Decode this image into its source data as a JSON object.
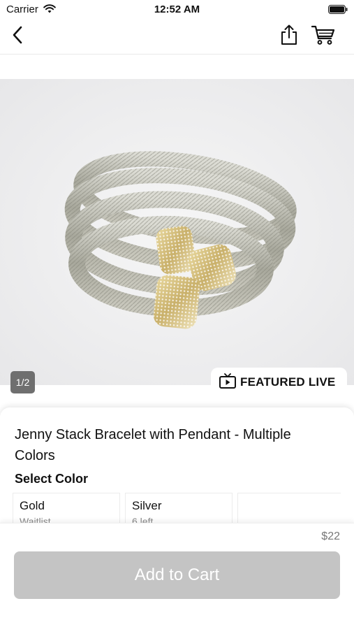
{
  "status_bar": {
    "carrier": "Carrier",
    "time": "12:52 AM"
  },
  "nav": {
    "back_icon": "chevron-left-icon",
    "share_icon": "share-icon",
    "cart_icon": "cart-icon"
  },
  "gallery": {
    "page_indicator": "1/2",
    "badge_icon": "tv-play-icon",
    "badge_label": "FEATURED LIVE"
  },
  "product": {
    "title": "Jenny Stack Bracelet with Pendant - Multiple Colors",
    "select_color_label": "Select Color",
    "colors": [
      {
        "name": "Gold",
        "status": "Waitlist"
      },
      {
        "name": "Silver",
        "status": "6 left"
      }
    ],
    "price": "$22"
  },
  "actions": {
    "add_to_cart": "Add to Cart"
  },
  "colors": {
    "button_disabled": "#c4c4c4",
    "indicator_bg": "#6f6f6f"
  }
}
